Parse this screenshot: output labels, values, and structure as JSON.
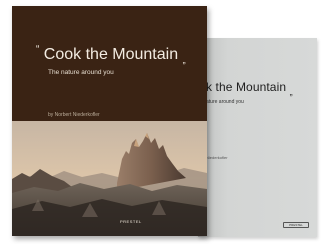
{
  "books": {
    "front": {
      "title": "Cook the Mountain",
      "open_quote": "“",
      "close_quote": "„",
      "subtitle": "The nature around you",
      "author": "by Norbert Niederkofler",
      "publisher_logo": "PRESTEL",
      "cover_color": "#3a2314"
    },
    "back": {
      "title": "k the Mountain",
      "close_quote": "„",
      "subtitle": "ature around you",
      "author": "Niederkofler",
      "publisher_logo": "PRESTEL",
      "cover_color": "#d5d7d6"
    }
  }
}
